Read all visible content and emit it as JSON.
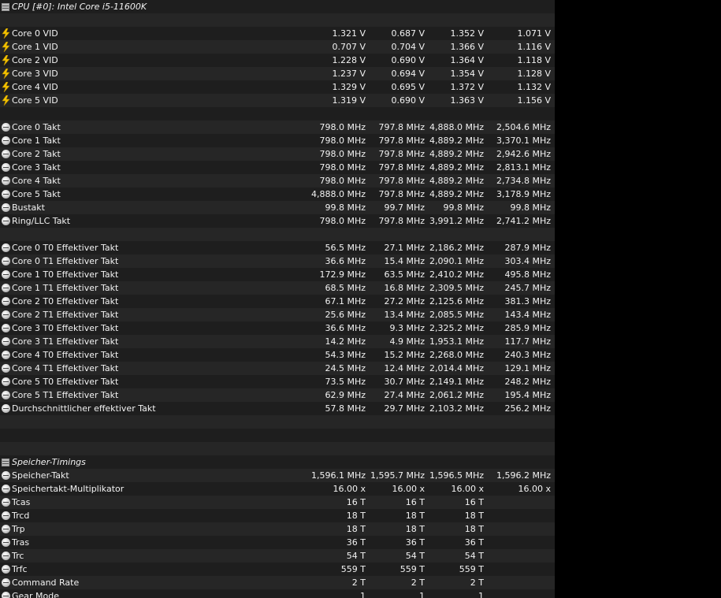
{
  "header": {
    "title": "CPU [#0]: Intel Core i5-11600K"
  },
  "sections": [
    {
      "type": "header",
      "label": "CPU [#0]: Intel Core i5-11600K",
      "icon": "chip-icon"
    },
    {
      "type": "blank"
    },
    {
      "type": "data",
      "icon": "bolt-icon",
      "label": "Core 0 VID",
      "values": [
        "1.321 V",
        "0.687 V",
        "1.352 V",
        "1.071 V"
      ]
    },
    {
      "type": "data",
      "icon": "bolt-icon",
      "label": "Core 1 VID",
      "values": [
        "0.707 V",
        "0.704 V",
        "1.366 V",
        "1.116 V"
      ]
    },
    {
      "type": "data",
      "icon": "bolt-icon",
      "label": "Core 2 VID",
      "values": [
        "1.228 V",
        "0.690 V",
        "1.364 V",
        "1.118 V"
      ]
    },
    {
      "type": "data",
      "icon": "bolt-icon",
      "label": "Core 3 VID",
      "values": [
        "1.237 V",
        "0.694 V",
        "1.354 V",
        "1.128 V"
      ]
    },
    {
      "type": "data",
      "icon": "bolt-icon",
      "label": "Core 4 VID",
      "values": [
        "1.329 V",
        "0.695 V",
        "1.372 V",
        "1.132 V"
      ]
    },
    {
      "type": "data",
      "icon": "bolt-icon",
      "label": "Core 5 VID",
      "values": [
        "1.319 V",
        "0.690 V",
        "1.363 V",
        "1.156 V"
      ]
    },
    {
      "type": "blank"
    },
    {
      "type": "data",
      "icon": "clock-icon",
      "label": "Core 0 Takt",
      "values": [
        "798.0 MHz",
        "797.8 MHz",
        "4,888.0 MHz",
        "2,504.6 MHz"
      ]
    },
    {
      "type": "data",
      "icon": "clock-icon",
      "label": "Core 1 Takt",
      "values": [
        "798.0 MHz",
        "797.8 MHz",
        "4,889.2 MHz",
        "3,370.1 MHz"
      ]
    },
    {
      "type": "data",
      "icon": "clock-icon",
      "label": "Core 2 Takt",
      "values": [
        "798.0 MHz",
        "797.8 MHz",
        "4,889.2 MHz",
        "2,942.6 MHz"
      ]
    },
    {
      "type": "data",
      "icon": "clock-icon",
      "label": "Core 3 Takt",
      "values": [
        "798.0 MHz",
        "797.8 MHz",
        "4,889.2 MHz",
        "2,813.1 MHz"
      ]
    },
    {
      "type": "data",
      "icon": "clock-icon",
      "label": "Core 4 Takt",
      "values": [
        "798.0 MHz",
        "797.8 MHz",
        "4,889.2 MHz",
        "2,734.8 MHz"
      ]
    },
    {
      "type": "data",
      "icon": "clock-icon",
      "label": "Core 5 Takt",
      "values": [
        "4,888.0 MHz",
        "797.8 MHz",
        "4,889.2 MHz",
        "3,178.9 MHz"
      ]
    },
    {
      "type": "data",
      "icon": "clock-icon",
      "label": "Bustakt",
      "values": [
        "99.8 MHz",
        "99.7 MHz",
        "99.8 MHz",
        "99.8 MHz"
      ]
    },
    {
      "type": "data",
      "icon": "clock-icon",
      "label": "Ring/LLC Takt",
      "values": [
        "798.0 MHz",
        "797.8 MHz",
        "3,991.2 MHz",
        "2,741.2 MHz"
      ]
    },
    {
      "type": "blank"
    },
    {
      "type": "data",
      "icon": "clock-icon",
      "label": "Core 0 T0 Effektiver Takt",
      "values": [
        "56.5 MHz",
        "27.1 MHz",
        "2,186.2 MHz",
        "287.9 MHz"
      ]
    },
    {
      "type": "data",
      "icon": "clock-icon",
      "label": "Core 0 T1 Effektiver Takt",
      "values": [
        "36.6 MHz",
        "15.4 MHz",
        "2,090.1 MHz",
        "303.4 MHz"
      ]
    },
    {
      "type": "data",
      "icon": "clock-icon",
      "label": "Core 1 T0 Effektiver Takt",
      "values": [
        "172.9 MHz",
        "63.5 MHz",
        "2,410.2 MHz",
        "495.8 MHz"
      ]
    },
    {
      "type": "data",
      "icon": "clock-icon",
      "label": "Core 1 T1 Effektiver Takt",
      "values": [
        "68.5 MHz",
        "16.8 MHz",
        "2,309.5 MHz",
        "245.7 MHz"
      ]
    },
    {
      "type": "data",
      "icon": "clock-icon",
      "label": "Core 2 T0 Effektiver Takt",
      "values": [
        "67.1 MHz",
        "27.2 MHz",
        "2,125.6 MHz",
        "381.3 MHz"
      ]
    },
    {
      "type": "data",
      "icon": "clock-icon",
      "label": "Core 2 T1 Effektiver Takt",
      "values": [
        "25.6 MHz",
        "13.4 MHz",
        "2,085.5 MHz",
        "143.4 MHz"
      ]
    },
    {
      "type": "data",
      "icon": "clock-icon",
      "label": "Core 3 T0 Effektiver Takt",
      "values": [
        "36.6 MHz",
        "9.3 MHz",
        "2,325.2 MHz",
        "285.9 MHz"
      ]
    },
    {
      "type": "data",
      "icon": "clock-icon",
      "label": "Core 3 T1 Effektiver Takt",
      "values": [
        "14.2 MHz",
        "4.9 MHz",
        "1,953.1 MHz",
        "117.7 MHz"
      ]
    },
    {
      "type": "data",
      "icon": "clock-icon",
      "label": "Core 4 T0 Effektiver Takt",
      "values": [
        "54.3 MHz",
        "15.2 MHz",
        "2,268.0 MHz",
        "240.3 MHz"
      ]
    },
    {
      "type": "data",
      "icon": "clock-icon",
      "label": "Core 4 T1 Effektiver Takt",
      "values": [
        "24.5 MHz",
        "12.4 MHz",
        "2,014.4 MHz",
        "129.1 MHz"
      ]
    },
    {
      "type": "data",
      "icon": "clock-icon",
      "label": "Core 5 T0 Effektiver Takt",
      "values": [
        "73.5 MHz",
        "30.7 MHz",
        "2,149.1 MHz",
        "248.2 MHz"
      ]
    },
    {
      "type": "data",
      "icon": "clock-icon",
      "label": "Core 5 T1 Effektiver Takt",
      "values": [
        "62.9 MHz",
        "27.4 MHz",
        "2,061.2 MHz",
        "195.4 MHz"
      ]
    },
    {
      "type": "data",
      "icon": "clock-icon",
      "label": "Durchschnittlicher effektiver Takt",
      "values": [
        "57.8 MHz",
        "29.7 MHz",
        "2,103.2 MHz",
        "256.2 MHz"
      ]
    },
    {
      "type": "blank"
    },
    {
      "type": "blank"
    },
    {
      "type": "blank"
    },
    {
      "type": "header",
      "label": "Speicher-Timings",
      "icon": "chip-icon"
    },
    {
      "type": "data",
      "icon": "clock-icon",
      "label": "Speicher-Takt",
      "values": [
        "1,596.1 MHz",
        "1,595.7 MHz",
        "1,596.5 MHz",
        "1,596.2 MHz"
      ]
    },
    {
      "type": "data",
      "icon": "clock-icon",
      "label": "Speichertakt-Multiplikator",
      "values": [
        "16.00 x",
        "16.00 x",
        "16.00 x",
        "16.00 x"
      ]
    },
    {
      "type": "data",
      "icon": "clock-icon",
      "label": "Tcas",
      "values": [
        "16 T",
        "16 T",
        "16 T",
        ""
      ]
    },
    {
      "type": "data",
      "icon": "clock-icon",
      "label": "Trcd",
      "values": [
        "18 T",
        "18 T",
        "18 T",
        ""
      ]
    },
    {
      "type": "data",
      "icon": "clock-icon",
      "label": "Trp",
      "values": [
        "18 T",
        "18 T",
        "18 T",
        ""
      ]
    },
    {
      "type": "data",
      "icon": "clock-icon",
      "label": "Tras",
      "values": [
        "36 T",
        "36 T",
        "36 T",
        ""
      ]
    },
    {
      "type": "data",
      "icon": "clock-icon",
      "label": "Trc",
      "values": [
        "54 T",
        "54 T",
        "54 T",
        ""
      ]
    },
    {
      "type": "data",
      "icon": "clock-icon",
      "label": "Trfc",
      "values": [
        "559 T",
        "559 T",
        "559 T",
        ""
      ]
    },
    {
      "type": "data",
      "icon": "clock-icon",
      "label": "Command Rate",
      "values": [
        "2 T",
        "2 T",
        "2 T",
        ""
      ]
    },
    {
      "type": "data",
      "icon": "clock-icon",
      "label": "Gear Mode",
      "values": [
        "1",
        "1",
        "1",
        ""
      ]
    }
  ]
}
